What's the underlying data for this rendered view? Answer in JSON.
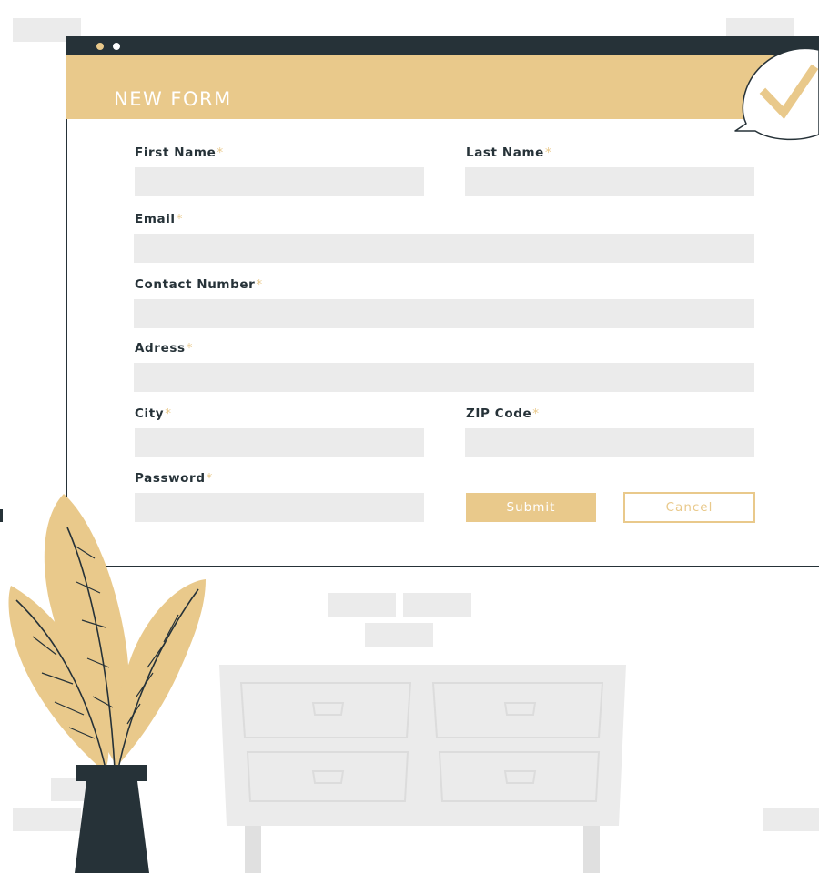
{
  "form": {
    "title": "NEW FORM",
    "required_marker": "*",
    "fields": {
      "first_name": {
        "label": "First Name",
        "value": ""
      },
      "last_name": {
        "label": "Last Name",
        "value": ""
      },
      "email": {
        "label": "Email",
        "value": ""
      },
      "contact_number": {
        "label": "Contact Number",
        "value": ""
      },
      "address": {
        "label": "Adress",
        "value": ""
      },
      "city": {
        "label": "City",
        "value": ""
      },
      "zip_code": {
        "label": "ZIP Code",
        "value": ""
      },
      "password": {
        "label": "Password",
        "value": ""
      }
    },
    "buttons": {
      "submit": "Submit",
      "cancel": "Cancel"
    }
  },
  "icons": {
    "badge": "checkmark-icon",
    "window_controls": "window-dots-icon",
    "plant": "plant-icon",
    "furniture": "dresser-icon"
  },
  "colors": {
    "accent": "#e9c98b",
    "dark": "#263238",
    "input_fill": "#ebebeb"
  }
}
